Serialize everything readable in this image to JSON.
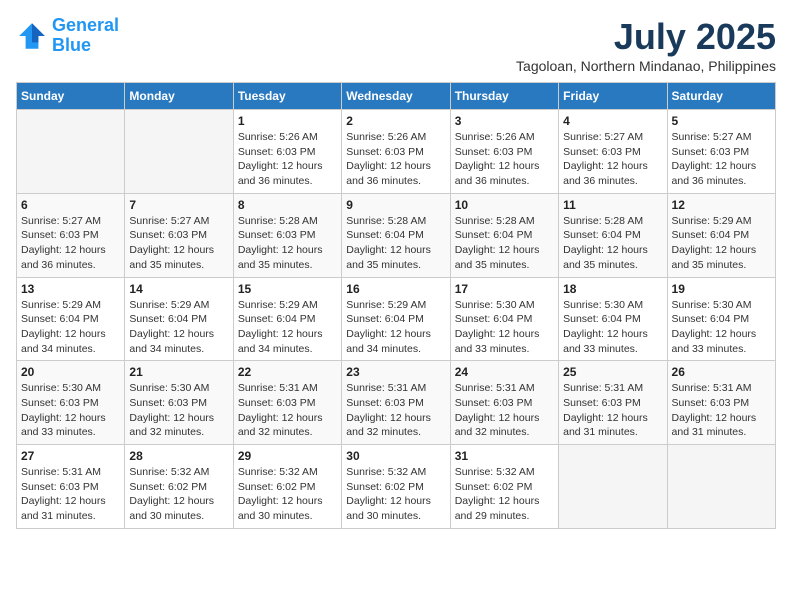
{
  "header": {
    "logo_line1": "General",
    "logo_line2": "Blue",
    "month": "July 2025",
    "location": "Tagoloan, Northern Mindanao, Philippines"
  },
  "weekdays": [
    "Sunday",
    "Monday",
    "Tuesday",
    "Wednesday",
    "Thursday",
    "Friday",
    "Saturday"
  ],
  "weeks": [
    [
      {
        "day": "",
        "info": ""
      },
      {
        "day": "",
        "info": ""
      },
      {
        "day": "1",
        "info": "Sunrise: 5:26 AM\nSunset: 6:03 PM\nDaylight: 12 hours and 36 minutes."
      },
      {
        "day": "2",
        "info": "Sunrise: 5:26 AM\nSunset: 6:03 PM\nDaylight: 12 hours and 36 minutes."
      },
      {
        "day": "3",
        "info": "Sunrise: 5:26 AM\nSunset: 6:03 PM\nDaylight: 12 hours and 36 minutes."
      },
      {
        "day": "4",
        "info": "Sunrise: 5:27 AM\nSunset: 6:03 PM\nDaylight: 12 hours and 36 minutes."
      },
      {
        "day": "5",
        "info": "Sunrise: 5:27 AM\nSunset: 6:03 PM\nDaylight: 12 hours and 36 minutes."
      }
    ],
    [
      {
        "day": "6",
        "info": "Sunrise: 5:27 AM\nSunset: 6:03 PM\nDaylight: 12 hours and 36 minutes."
      },
      {
        "day": "7",
        "info": "Sunrise: 5:27 AM\nSunset: 6:03 PM\nDaylight: 12 hours and 35 minutes."
      },
      {
        "day": "8",
        "info": "Sunrise: 5:28 AM\nSunset: 6:03 PM\nDaylight: 12 hours and 35 minutes."
      },
      {
        "day": "9",
        "info": "Sunrise: 5:28 AM\nSunset: 6:04 PM\nDaylight: 12 hours and 35 minutes."
      },
      {
        "day": "10",
        "info": "Sunrise: 5:28 AM\nSunset: 6:04 PM\nDaylight: 12 hours and 35 minutes."
      },
      {
        "day": "11",
        "info": "Sunrise: 5:28 AM\nSunset: 6:04 PM\nDaylight: 12 hours and 35 minutes."
      },
      {
        "day": "12",
        "info": "Sunrise: 5:29 AM\nSunset: 6:04 PM\nDaylight: 12 hours and 35 minutes."
      }
    ],
    [
      {
        "day": "13",
        "info": "Sunrise: 5:29 AM\nSunset: 6:04 PM\nDaylight: 12 hours and 34 minutes."
      },
      {
        "day": "14",
        "info": "Sunrise: 5:29 AM\nSunset: 6:04 PM\nDaylight: 12 hours and 34 minutes."
      },
      {
        "day": "15",
        "info": "Sunrise: 5:29 AM\nSunset: 6:04 PM\nDaylight: 12 hours and 34 minutes."
      },
      {
        "day": "16",
        "info": "Sunrise: 5:29 AM\nSunset: 6:04 PM\nDaylight: 12 hours and 34 minutes."
      },
      {
        "day": "17",
        "info": "Sunrise: 5:30 AM\nSunset: 6:04 PM\nDaylight: 12 hours and 33 minutes."
      },
      {
        "day": "18",
        "info": "Sunrise: 5:30 AM\nSunset: 6:04 PM\nDaylight: 12 hours and 33 minutes."
      },
      {
        "day": "19",
        "info": "Sunrise: 5:30 AM\nSunset: 6:04 PM\nDaylight: 12 hours and 33 minutes."
      }
    ],
    [
      {
        "day": "20",
        "info": "Sunrise: 5:30 AM\nSunset: 6:03 PM\nDaylight: 12 hours and 33 minutes."
      },
      {
        "day": "21",
        "info": "Sunrise: 5:30 AM\nSunset: 6:03 PM\nDaylight: 12 hours and 32 minutes."
      },
      {
        "day": "22",
        "info": "Sunrise: 5:31 AM\nSunset: 6:03 PM\nDaylight: 12 hours and 32 minutes."
      },
      {
        "day": "23",
        "info": "Sunrise: 5:31 AM\nSunset: 6:03 PM\nDaylight: 12 hours and 32 minutes."
      },
      {
        "day": "24",
        "info": "Sunrise: 5:31 AM\nSunset: 6:03 PM\nDaylight: 12 hours and 32 minutes."
      },
      {
        "day": "25",
        "info": "Sunrise: 5:31 AM\nSunset: 6:03 PM\nDaylight: 12 hours and 31 minutes."
      },
      {
        "day": "26",
        "info": "Sunrise: 5:31 AM\nSunset: 6:03 PM\nDaylight: 12 hours and 31 minutes."
      }
    ],
    [
      {
        "day": "27",
        "info": "Sunrise: 5:31 AM\nSunset: 6:03 PM\nDaylight: 12 hours and 31 minutes."
      },
      {
        "day": "28",
        "info": "Sunrise: 5:32 AM\nSunset: 6:02 PM\nDaylight: 12 hours and 30 minutes."
      },
      {
        "day": "29",
        "info": "Sunrise: 5:32 AM\nSunset: 6:02 PM\nDaylight: 12 hours and 30 minutes."
      },
      {
        "day": "30",
        "info": "Sunrise: 5:32 AM\nSunset: 6:02 PM\nDaylight: 12 hours and 30 minutes."
      },
      {
        "day": "31",
        "info": "Sunrise: 5:32 AM\nSunset: 6:02 PM\nDaylight: 12 hours and 29 minutes."
      },
      {
        "day": "",
        "info": ""
      },
      {
        "day": "",
        "info": ""
      }
    ]
  ]
}
